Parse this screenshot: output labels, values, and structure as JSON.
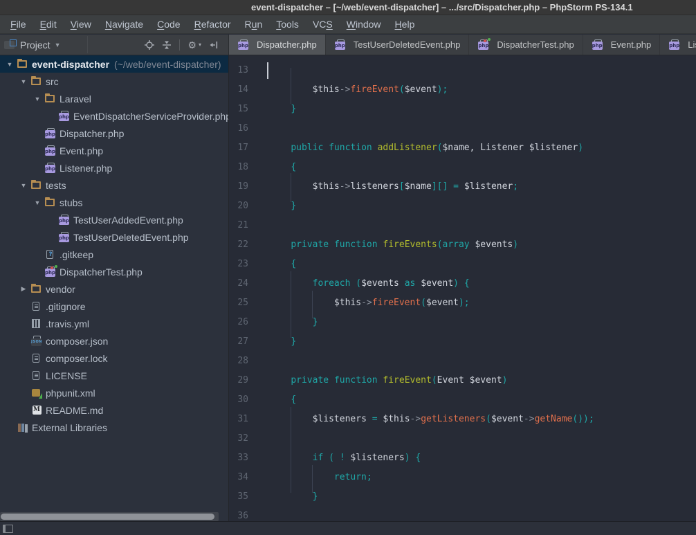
{
  "window": {
    "title": "event-dispatcher – [~/web/event-dispatcher] – .../src/Dispatcher.php – PhpStorm PS-134.1"
  },
  "menubar": {
    "items": [
      {
        "label": "File",
        "mnemonic": 0
      },
      {
        "label": "Edit",
        "mnemonic": 0
      },
      {
        "label": "View",
        "mnemonic": 0
      },
      {
        "label": "Navigate",
        "mnemonic": 0
      },
      {
        "label": "Code",
        "mnemonic": 0
      },
      {
        "label": "Refactor",
        "mnemonic": 0
      },
      {
        "label": "Run",
        "mnemonic": 1
      },
      {
        "label": "Tools",
        "mnemonic": 0
      },
      {
        "label": "VCS",
        "mnemonic": 2
      },
      {
        "label": "Window",
        "mnemonic": 0
      },
      {
        "label": "Help",
        "mnemonic": 0
      }
    ]
  },
  "toolwindow_header": {
    "title": "Project",
    "icons": [
      "locate-icon",
      "collapse-all-icon",
      "settings-icon",
      "hide-icon"
    ]
  },
  "tabs": [
    {
      "label": "Dispatcher.php",
      "icon": "php",
      "active": true
    },
    {
      "label": "TestUserDeletedEvent.php",
      "icon": "php",
      "active": false
    },
    {
      "label": "DispatcherTest.php",
      "icon": "php-test",
      "active": false
    },
    {
      "label": "Event.php",
      "icon": "php",
      "active": false
    },
    {
      "label": "Listener.php",
      "icon": "php",
      "active": false
    }
  ],
  "project_tree": {
    "items": [
      {
        "depth": 0,
        "arrow": "expanded",
        "icon": "folder",
        "label": "event-dispatcher",
        "note": "(~/web/event-dispatcher)",
        "selected": true,
        "bold": true
      },
      {
        "depth": 1,
        "arrow": "expanded",
        "icon": "folder",
        "label": "src"
      },
      {
        "depth": 2,
        "arrow": "expanded",
        "icon": "folder",
        "label": "Laravel"
      },
      {
        "depth": 3,
        "arrow": "none",
        "icon": "php",
        "label": "EventDispatcherServiceProvider.php"
      },
      {
        "depth": 2,
        "arrow": "none",
        "icon": "php",
        "label": "Dispatcher.php"
      },
      {
        "depth": 2,
        "arrow": "none",
        "icon": "php",
        "label": "Event.php"
      },
      {
        "depth": 2,
        "arrow": "none",
        "icon": "php",
        "label": "Listener.php"
      },
      {
        "depth": 1,
        "arrow": "expanded",
        "icon": "folder",
        "label": "tests"
      },
      {
        "depth": 2,
        "arrow": "expanded",
        "icon": "folder",
        "label": "stubs"
      },
      {
        "depth": 3,
        "arrow": "none",
        "icon": "php",
        "label": "TestUserAddedEvent.php"
      },
      {
        "depth": 3,
        "arrow": "none",
        "icon": "php",
        "label": "TestUserDeletedEvent.php"
      },
      {
        "depth": 2,
        "arrow": "none",
        "icon": "unknown",
        "label": ".gitkeep"
      },
      {
        "depth": 2,
        "arrow": "none",
        "icon": "php-test",
        "label": "DispatcherTest.php"
      },
      {
        "depth": 1,
        "arrow": "collapsed",
        "icon": "folder",
        "label": "vendor"
      },
      {
        "depth": 1,
        "arrow": "none",
        "icon": "file",
        "label": ".gitignore"
      },
      {
        "depth": 1,
        "arrow": "none",
        "icon": "yaml",
        "label": ".travis.yml"
      },
      {
        "depth": 1,
        "arrow": "none",
        "icon": "json",
        "label": "composer.json"
      },
      {
        "depth": 1,
        "arrow": "none",
        "icon": "file",
        "label": "composer.lock"
      },
      {
        "depth": 1,
        "arrow": "none",
        "icon": "file",
        "label": "LICENSE"
      },
      {
        "depth": 1,
        "arrow": "none",
        "icon": "phpunit",
        "label": "phpunit.xml"
      },
      {
        "depth": 1,
        "arrow": "none",
        "icon": "markdown",
        "label": "README.md"
      },
      {
        "depth": 0,
        "arrow": "none",
        "icon": "library",
        "label": "External Libraries"
      }
    ]
  },
  "editor": {
    "caret_line": 13,
    "lines": [
      {
        "n": 13,
        "t": []
      },
      {
        "n": 14,
        "t": [
          [
            "        ",
            "w"
          ],
          [
            "$this",
            "v"
          ],
          [
            "->",
            "o"
          ],
          [
            "fireEvent",
            "m"
          ],
          [
            "(",
            "p"
          ],
          [
            "$event",
            "v"
          ],
          [
            ")",
            "p"
          ],
          [
            ";",
            "p"
          ]
        ]
      },
      {
        "n": 15,
        "t": [
          [
            "    ",
            "w"
          ],
          [
            "}",
            "p"
          ]
        ]
      },
      {
        "n": 16,
        "t": []
      },
      {
        "n": 17,
        "t": [
          [
            "    ",
            "w"
          ],
          [
            "public",
            "k"
          ],
          [
            " ",
            "w"
          ],
          [
            "function",
            "k"
          ],
          [
            " ",
            "w"
          ],
          [
            "addListener",
            "f"
          ],
          [
            "(",
            "p"
          ],
          [
            "$name",
            "v"
          ],
          [
            ", ",
            "w"
          ],
          [
            "Listener",
            "v"
          ],
          [
            " ",
            "w"
          ],
          [
            "$listener",
            "v"
          ],
          [
            ")",
            "p"
          ]
        ]
      },
      {
        "n": 18,
        "t": [
          [
            "    ",
            "w"
          ],
          [
            "{",
            "p"
          ]
        ]
      },
      {
        "n": 19,
        "t": [
          [
            "        ",
            "w"
          ],
          [
            "$this",
            "v"
          ],
          [
            "->",
            "o"
          ],
          [
            "listeners",
            "v"
          ],
          [
            "[",
            "p"
          ],
          [
            "$name",
            "v"
          ],
          [
            "]",
            "p"
          ],
          [
            "[]",
            "p"
          ],
          [
            " ",
            "w"
          ],
          [
            "=",
            "p"
          ],
          [
            " ",
            "w"
          ],
          [
            "$listener",
            "v"
          ],
          [
            ";",
            "p"
          ]
        ]
      },
      {
        "n": 20,
        "t": [
          [
            "    ",
            "w"
          ],
          [
            "}",
            "p"
          ]
        ]
      },
      {
        "n": 21,
        "t": []
      },
      {
        "n": 22,
        "t": [
          [
            "    ",
            "w"
          ],
          [
            "private",
            "k"
          ],
          [
            " ",
            "w"
          ],
          [
            "function",
            "k"
          ],
          [
            " ",
            "w"
          ],
          [
            "fireEvents",
            "f"
          ],
          [
            "(",
            "p"
          ],
          [
            "array",
            "k"
          ],
          [
            " ",
            "w"
          ],
          [
            "$events",
            "v"
          ],
          [
            ")",
            "p"
          ]
        ]
      },
      {
        "n": 23,
        "t": [
          [
            "    ",
            "w"
          ],
          [
            "{",
            "p"
          ]
        ]
      },
      {
        "n": 24,
        "t": [
          [
            "        ",
            "w"
          ],
          [
            "foreach",
            "k"
          ],
          [
            " ",
            "w"
          ],
          [
            "(",
            "p"
          ],
          [
            "$events",
            "v"
          ],
          [
            " ",
            "w"
          ],
          [
            "as",
            "k"
          ],
          [
            " ",
            "w"
          ],
          [
            "$event",
            "v"
          ],
          [
            ")",
            "p"
          ],
          [
            " ",
            "w"
          ],
          [
            "{",
            "p"
          ]
        ]
      },
      {
        "n": 25,
        "t": [
          [
            "            ",
            "w"
          ],
          [
            "$this",
            "v"
          ],
          [
            "->",
            "o"
          ],
          [
            "fireEvent",
            "m"
          ],
          [
            "(",
            "p"
          ],
          [
            "$event",
            "v"
          ],
          [
            ")",
            "p"
          ],
          [
            ";",
            "p"
          ]
        ]
      },
      {
        "n": 26,
        "t": [
          [
            "        ",
            "w"
          ],
          [
            "}",
            "p"
          ]
        ]
      },
      {
        "n": 27,
        "t": [
          [
            "    ",
            "w"
          ],
          [
            "}",
            "p"
          ]
        ]
      },
      {
        "n": 28,
        "t": []
      },
      {
        "n": 29,
        "t": [
          [
            "    ",
            "w"
          ],
          [
            "private",
            "k"
          ],
          [
            " ",
            "w"
          ],
          [
            "function",
            "k"
          ],
          [
            " ",
            "w"
          ],
          [
            "fireEvent",
            "f"
          ],
          [
            "(",
            "p"
          ],
          [
            "Event",
            "v"
          ],
          [
            " ",
            "w"
          ],
          [
            "$event",
            "v"
          ],
          [
            ")",
            "p"
          ]
        ]
      },
      {
        "n": 30,
        "t": [
          [
            "    ",
            "w"
          ],
          [
            "{",
            "p"
          ]
        ]
      },
      {
        "n": 31,
        "t": [
          [
            "        ",
            "w"
          ],
          [
            "$listeners",
            "v"
          ],
          [
            " ",
            "w"
          ],
          [
            "=",
            "p"
          ],
          [
            " ",
            "w"
          ],
          [
            "$this",
            "v"
          ],
          [
            "->",
            "o"
          ],
          [
            "getListeners",
            "m"
          ],
          [
            "(",
            "p"
          ],
          [
            "$event",
            "v"
          ],
          [
            "->",
            "o"
          ],
          [
            "getName",
            "m"
          ],
          [
            "(",
            "p"
          ],
          [
            ")",
            "p"
          ],
          [
            ")",
            "p"
          ],
          [
            ";",
            "p"
          ]
        ]
      },
      {
        "n": 32,
        "t": []
      },
      {
        "n": 33,
        "t": [
          [
            "        ",
            "w"
          ],
          [
            "if",
            "k"
          ],
          [
            " ",
            "w"
          ],
          [
            "(",
            "p"
          ],
          [
            " ",
            "w"
          ],
          [
            "!",
            "p"
          ],
          [
            " ",
            "w"
          ],
          [
            "$listeners",
            "v"
          ],
          [
            ")",
            "p"
          ],
          [
            " ",
            "w"
          ],
          [
            "{",
            "p"
          ]
        ]
      },
      {
        "n": 34,
        "t": [
          [
            "            ",
            "w"
          ],
          [
            "return",
            "k"
          ],
          [
            ";",
            "p"
          ]
        ]
      },
      {
        "n": 35,
        "t": [
          [
            "        ",
            "w"
          ],
          [
            "}",
            "p"
          ]
        ]
      },
      {
        "n": 36,
        "t": []
      }
    ]
  },
  "icon_text": {
    "php": "php",
    "json": "JSON",
    "markdown": "M",
    "unknown": "?"
  },
  "colors": {
    "titlebar_bg": "#373737",
    "menubar_bg": "#3c3f41",
    "band_bg": "#3b3e42",
    "active_tab_bg": "#515458",
    "panel_bg": "#2c313c",
    "editor_bg": "#272b36",
    "selection_bg": "#0c2a42",
    "keyword": "#1fa8a8",
    "function_decl": "#b3bd2d",
    "method_call": "#e2704c",
    "variable": "#d2d6de",
    "operator": "#8b919c",
    "line_number": "#5f6672",
    "folder_icon": "#b78e52",
    "php_icon": "#a89ae0",
    "ui_text": "#bfc6d1"
  }
}
